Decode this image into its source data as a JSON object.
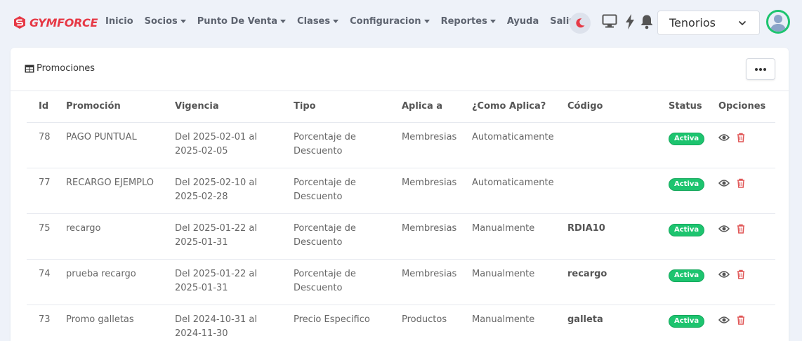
{
  "brand": {
    "name": "GYMFORCE"
  },
  "nav": {
    "items": [
      {
        "label": "Inicio",
        "dropdown": false
      },
      {
        "label": "Socios",
        "dropdown": true
      },
      {
        "label": "Punto De Venta",
        "dropdown": true
      },
      {
        "label": "Clases",
        "dropdown": true
      },
      {
        "label": "Configuracion",
        "dropdown": true
      },
      {
        "label": "Reportes",
        "dropdown": true
      },
      {
        "label": "Ayuda",
        "dropdown": false
      },
      {
        "label": "Salir",
        "dropdown": false
      }
    ]
  },
  "gym_select": {
    "value": "Tenorios"
  },
  "card": {
    "title": "Promociones"
  },
  "table": {
    "headers": [
      "Id",
      "Promoción",
      "Vigencia",
      "Tipo",
      "Aplica a",
      "¿Como Aplica?",
      "Código",
      "Status",
      "Opciones"
    ],
    "rows": [
      {
        "id": "78",
        "promo": "PAGO PUNTUAL",
        "vig1": "Del 2025-02-01 al",
        "vig2": "2025-02-05",
        "tipo1": "Porcentaje de",
        "tipo2": "Descuento",
        "aplica": "Membresias",
        "como": "Automaticamente",
        "codigo": "",
        "status": "Activa"
      },
      {
        "id": "77",
        "promo": "RECARGO EJEMPLO",
        "vig1": "Del 2025-02-10 al",
        "vig2": "2025-02-28",
        "tipo1": "Porcentaje de",
        "tipo2": "Descuento",
        "aplica": "Membresias",
        "como": "Automaticamente",
        "codigo": "",
        "status": "Activa"
      },
      {
        "id": "75",
        "promo": "recargo",
        "vig1": "Del 2025-01-22 al",
        "vig2": "2025-01-31",
        "tipo1": "Porcentaje de",
        "tipo2": "Descuento",
        "aplica": "Membresias",
        "como": "Manualmente",
        "codigo": "RDIA10",
        "status": "Activa"
      },
      {
        "id": "74",
        "promo": "prueba recargo",
        "vig1": "Del 2025-01-22 al",
        "vig2": "2025-01-31",
        "tipo1": "Porcentaje de",
        "tipo2": "Descuento",
        "aplica": "Membresias",
        "como": "Manualmente",
        "codigo": "recargo",
        "status": "Activa"
      },
      {
        "id": "73",
        "promo": "Promo galletas",
        "vig1": "Del 2024-10-31 al",
        "vig2": "2024-11-30",
        "tipo1": "Precio Especifico",
        "tipo2": "",
        "aplica": "Productos",
        "como": "Manualmente",
        "codigo": "galleta",
        "status": "Activa"
      }
    ]
  },
  "colors": {
    "brand": "#e63946",
    "status_active": "#1dc46f",
    "delete": "#e05656"
  },
  "icons": [
    "moon-icon",
    "monitor-icon",
    "bolt-icon",
    "bell-icon",
    "chevron-down-icon",
    "table-icon",
    "more-icon",
    "eye-icon",
    "trash-icon"
  ]
}
